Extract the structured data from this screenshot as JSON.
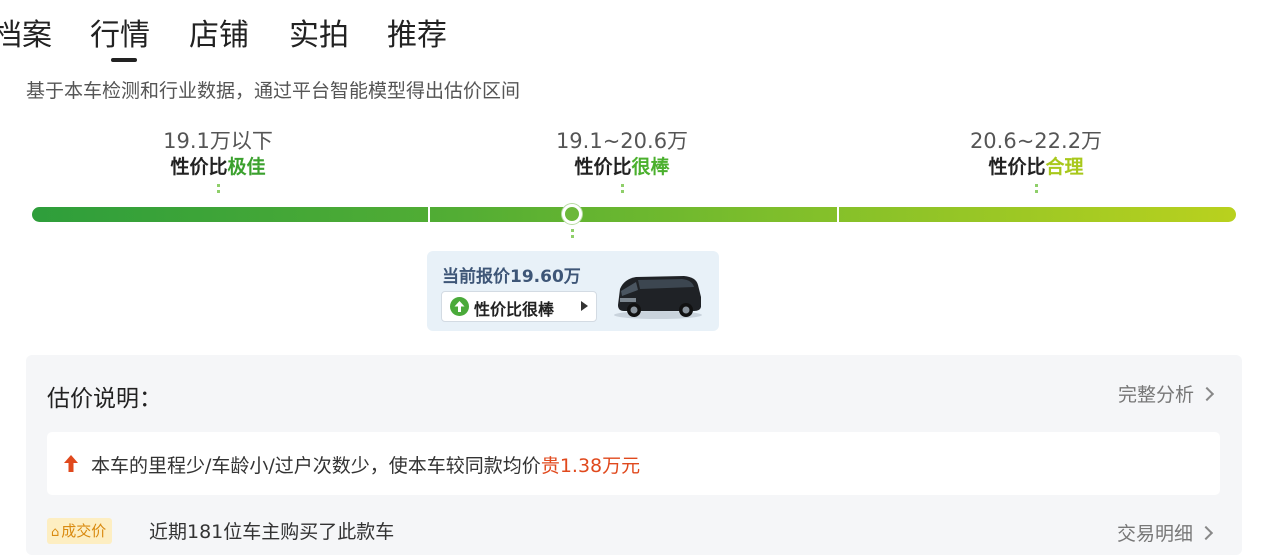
{
  "tabs": [
    {
      "label": "档案"
    },
    {
      "label": "行情",
      "active": true
    },
    {
      "label": "店铺"
    },
    {
      "label": "实拍"
    },
    {
      "label": "推荐"
    }
  ],
  "subtitle": "基于本车检测和行业数据，通过平台智能模型得出估价区间",
  "ranges": [
    {
      "price": "19.1万以下",
      "prefix": "性价比",
      "level": "极佳",
      "color": "#3ba12e"
    },
    {
      "price": "19.1~20.6万",
      "prefix": "性价比",
      "level": "很棒",
      "color": "#4bb02e"
    },
    {
      "price": "20.6~22.2万",
      "prefix": "性价比",
      "level": "合理",
      "color": "#a8c81b"
    }
  ],
  "quote": {
    "label": "当前报价19.60万",
    "badge": "性价比很棒",
    "value_wan": 19.6
  },
  "explain": {
    "title": "估价说明：",
    "link": "完整分析",
    "note_prefix": "本车的里程少/车龄小/过户次数少，使本车较同款均价",
    "note_highlight": "贵1.38万元"
  },
  "deal": {
    "badge": "成交价",
    "text": "近期181位车主购买了此款车",
    "link": "交易明细"
  },
  "colors": {
    "highlight": "#e0491d",
    "accent_green": "#4aaa3a"
  },
  "icons": [
    "up-circle-icon",
    "triangle-right-icon",
    "red-up-arrow-icon",
    "chevron-right-icon",
    "deal-tag-icon"
  ]
}
